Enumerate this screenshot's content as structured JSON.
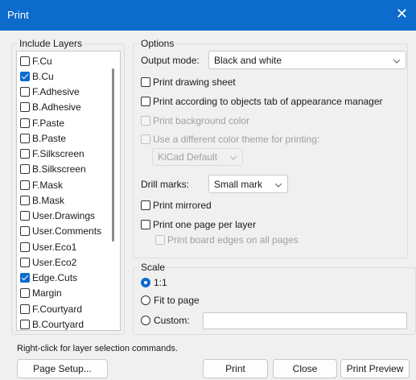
{
  "window": {
    "title": "Print",
    "close_glyph": "✕"
  },
  "layers": {
    "title": "Include Layers",
    "items": [
      {
        "label": "F.Cu",
        "checked": false
      },
      {
        "label": "B.Cu",
        "checked": true
      },
      {
        "label": "F.Adhesive",
        "checked": false
      },
      {
        "label": "B.Adhesive",
        "checked": false
      },
      {
        "label": "F.Paste",
        "checked": false
      },
      {
        "label": "B.Paste",
        "checked": false
      },
      {
        "label": "F.Silkscreen",
        "checked": false
      },
      {
        "label": "B.Silkscreen",
        "checked": false
      },
      {
        "label": "F.Mask",
        "checked": false
      },
      {
        "label": "B.Mask",
        "checked": false
      },
      {
        "label": "User.Drawings",
        "checked": false
      },
      {
        "label": "User.Comments",
        "checked": false
      },
      {
        "label": "User.Eco1",
        "checked": false
      },
      {
        "label": "User.Eco2",
        "checked": false
      },
      {
        "label": "Edge.Cuts",
        "checked": true
      },
      {
        "label": "Margin",
        "checked": false
      },
      {
        "label": "F.Courtyard",
        "checked": false
      },
      {
        "label": "B.Courtyard",
        "checked": false
      }
    ]
  },
  "options": {
    "title": "Options",
    "output_mode_label": "Output mode:",
    "output_mode_value": "Black and white",
    "print_drawing_sheet": "Print drawing sheet",
    "print_according": "Print according to objects tab of appearance manager",
    "print_background": "Print background color",
    "use_color_theme": "Use a different color theme for printing:",
    "color_theme_value": "KiCad Default",
    "drill_marks_label": "Drill marks:",
    "drill_marks_value": "Small mark",
    "print_mirrored": "Print mirrored",
    "print_one_page": "Print one page per layer",
    "print_board_edges": "Print board edges on all pages"
  },
  "scale": {
    "title": "Scale",
    "one_to_one": "1:1",
    "fit_to_page": "Fit to page",
    "custom": "Custom:",
    "custom_value": ""
  },
  "footnote": "Right-click for layer selection commands.",
  "buttons": {
    "page_setup": "Page Setup...",
    "print": "Print",
    "close": "Close",
    "print_preview": "Print Preview"
  },
  "colors": {
    "accent": "#0d6bcc"
  }
}
